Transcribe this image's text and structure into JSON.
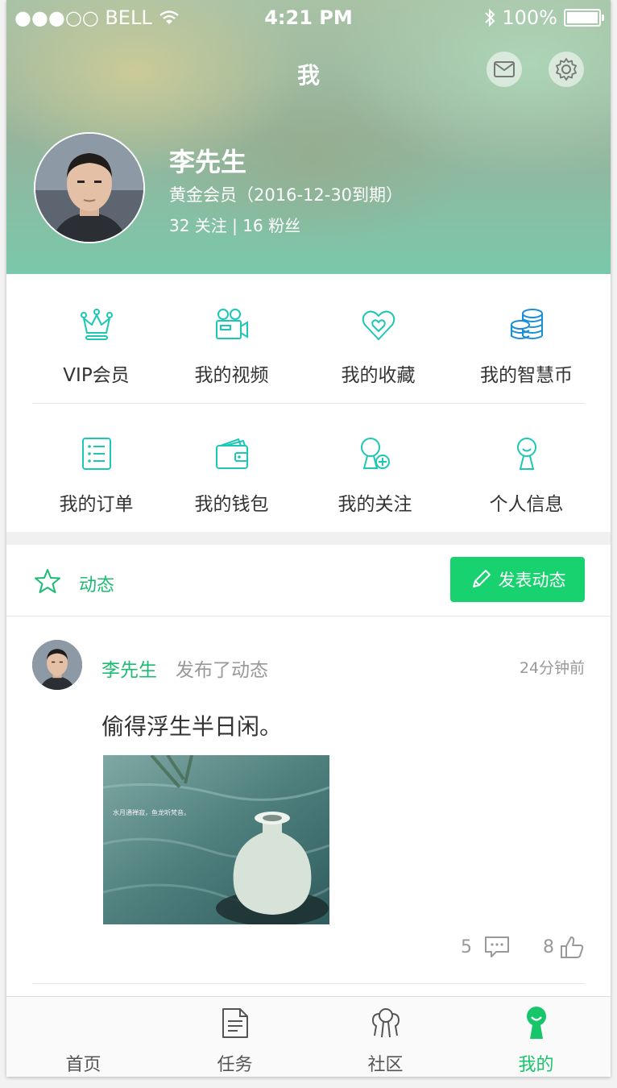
{
  "status_bar": {
    "carrier": "●●●○○ BELL",
    "time": "4:21 PM",
    "battery": "100%"
  },
  "nav": {
    "title": "我"
  },
  "profile": {
    "name": "李先生",
    "membership": "黄金会员（2016-12-30到期）",
    "follow_stats": "32 关注 | 16 粉丝"
  },
  "menu": [
    {
      "label": "VIP会员",
      "icon": "crown-icon"
    },
    {
      "label": "我的视频",
      "icon": "video-camera-icon"
    },
    {
      "label": "我的收藏",
      "icon": "heart-icon"
    },
    {
      "label": "我的智慧币",
      "icon": "coins-icon"
    },
    {
      "label": "我的订单",
      "icon": "list-icon"
    },
    {
      "label": "我的钱包",
      "icon": "wallet-icon"
    },
    {
      "label": "我的关注",
      "icon": "add-user-icon"
    },
    {
      "label": "个人信息",
      "icon": "person-icon"
    }
  ],
  "feed": {
    "section_label": "动态",
    "post_button": "发表动态",
    "post": {
      "author": "李先生",
      "action": "发布了动态",
      "time": "24分钟前",
      "text": "偷得浮生半日闲。",
      "image_caption": "水月通禅寂，鱼龙听梵音。",
      "comments": "5",
      "likes": "8"
    }
  },
  "tabs": [
    {
      "label": "首页",
      "icon": "home-icon",
      "active": false
    },
    {
      "label": "任务",
      "icon": "document-icon",
      "active": false
    },
    {
      "label": "社区",
      "icon": "community-icon",
      "active": false
    },
    {
      "label": "我的",
      "icon": "me-icon",
      "active": true
    }
  ],
  "colors": {
    "accent": "#17d26f",
    "accent_text": "#1dba72",
    "icon_teal": "#1cc7b4",
    "icon_blue": "#1a8fd8"
  }
}
